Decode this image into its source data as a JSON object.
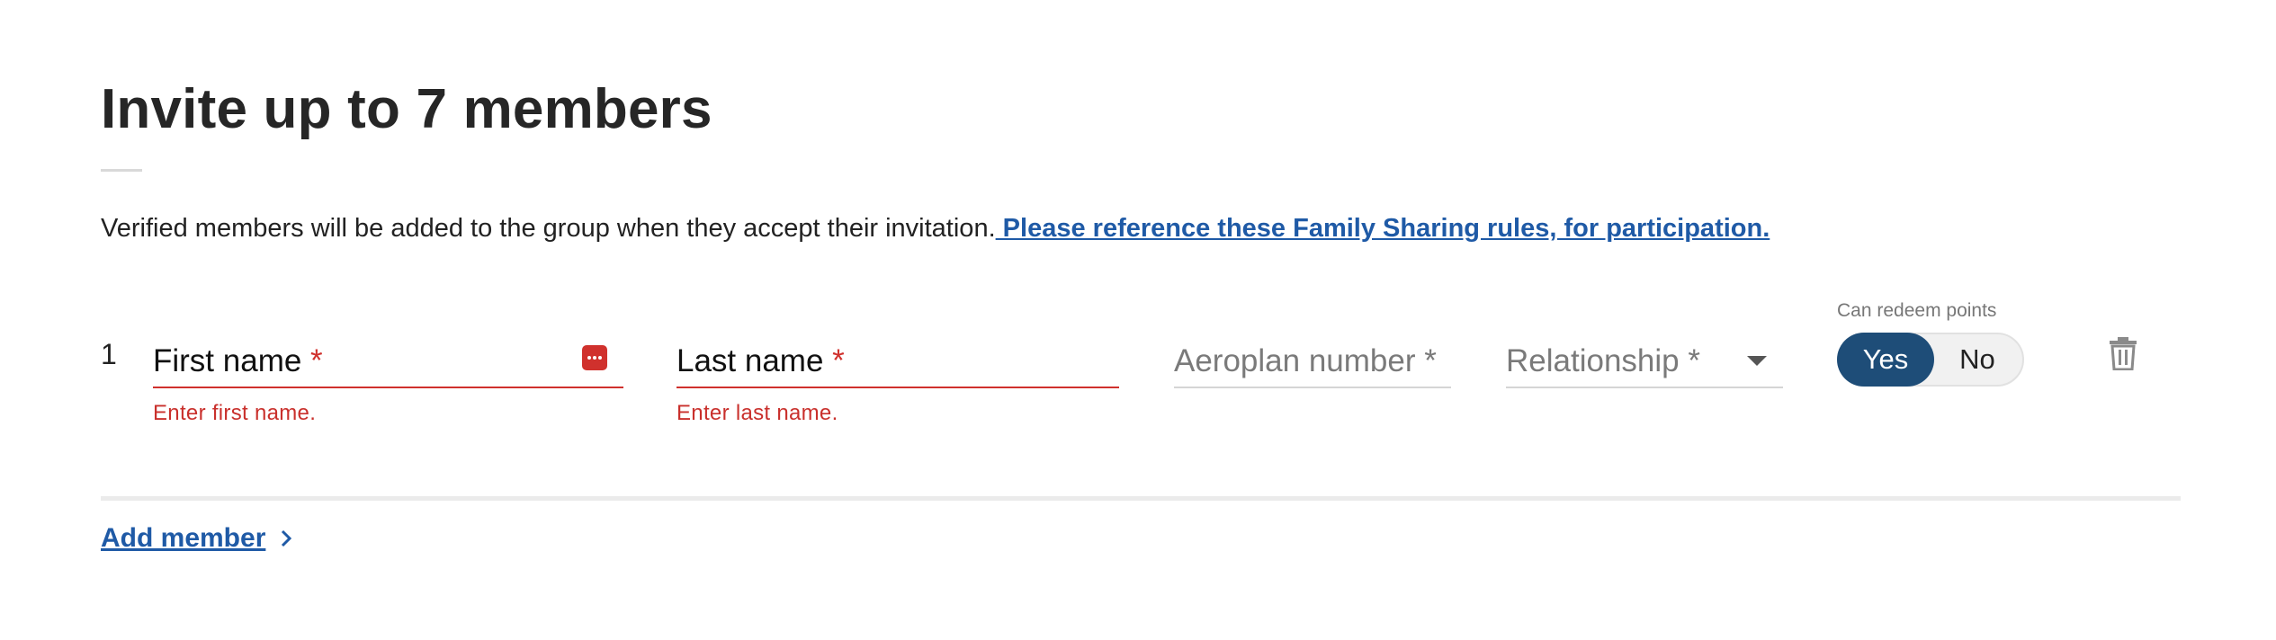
{
  "page": {
    "title": "Invite up to 7 members",
    "intro_text": "Verified members will be added to the group when they accept their invitation.",
    "intro_link": " Please reference these Family Sharing rules, for participation."
  },
  "member_row": {
    "index": "1",
    "first_name": {
      "label": "First name",
      "required_mark": "*",
      "error": "Enter first name."
    },
    "last_name": {
      "label": "Last name",
      "required_mark": "*",
      "error": "Enter last name."
    },
    "aeroplan_number": {
      "label": "Aeroplan number *"
    },
    "relationship": {
      "label": "Relationship *"
    },
    "redeem": {
      "label": "Can redeem points",
      "yes": "Yes",
      "no": "No",
      "selected": "Yes"
    }
  },
  "actions": {
    "add_member": "Add member"
  },
  "colors": {
    "accent_blue": "#1f5aa6",
    "toggle_active": "#1e4d78",
    "error_red": "#d0312d"
  },
  "icons": [
    "autofill-menu-icon",
    "dropdown-caret-icon",
    "trash-icon",
    "chevron-right-icon"
  ]
}
